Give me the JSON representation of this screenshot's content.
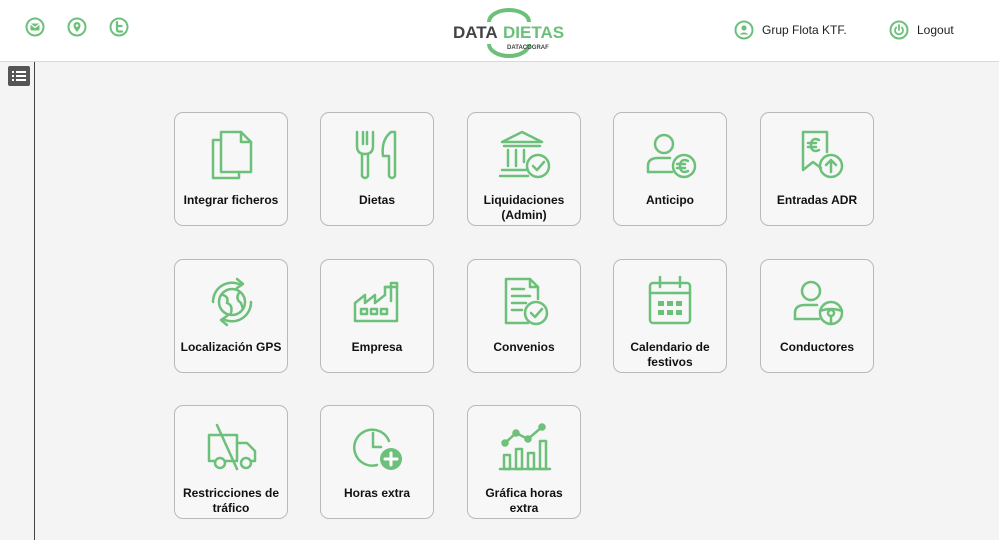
{
  "header": {
    "logo_text_left": "DATA",
    "logo_text_right": "DIETAS",
    "logo_subtext": "DATACOGRAF",
    "user_label": "Grup Flota KTF.",
    "logout_label": "Logout",
    "icons": [
      "email-icon",
      "location-icon",
      "twitter-icon",
      "user-icon",
      "power-icon"
    ]
  },
  "accent_color": "#6cc07a",
  "tiles": [
    {
      "label": "Integrar ficheros",
      "icon": "files-icon"
    },
    {
      "label": "Dietas",
      "icon": "fork-knife-icon"
    },
    {
      "label": "Liquidaciones (Admin)",
      "icon": "bank-check-icon"
    },
    {
      "label": "Anticipo",
      "icon": "user-euro-icon"
    },
    {
      "label": "Entradas ADR",
      "icon": "receipt-euro-icon"
    },
    {
      "label": "Localización GPS",
      "icon": "globe-refresh-icon"
    },
    {
      "label": "Empresa",
      "icon": "factory-icon"
    },
    {
      "label": "Convenios",
      "icon": "document-check-icon"
    },
    {
      "label": "Calendario de festivos",
      "icon": "calendar-icon"
    },
    {
      "label": "Conductores",
      "icon": "driver-icon"
    },
    {
      "label": "Restricciones de tráfico",
      "icon": "truck-restricted-icon"
    },
    {
      "label": "Horas extra",
      "icon": "clock-plus-icon"
    },
    {
      "label": "Gráfica horas extra",
      "icon": "chart-icon"
    }
  ]
}
